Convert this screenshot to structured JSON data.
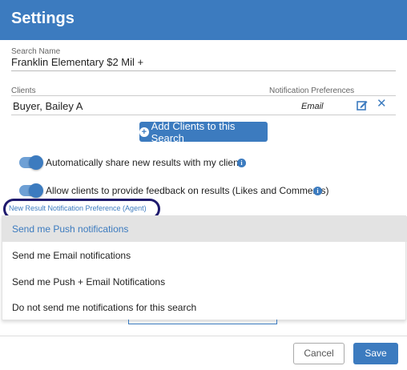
{
  "header": {
    "title": "Settings"
  },
  "search": {
    "label": "Search Name",
    "value": "Franklin Elementary $2 Mil +"
  },
  "clients": {
    "label": "Clients",
    "notification_label": "Notification Preferences",
    "rows": [
      {
        "name": "Buyer, Bailey A",
        "preference": "Email"
      }
    ],
    "add_button": "Add Clients to this Search"
  },
  "toggles": [
    {
      "label": "Automatically share new results with my clients",
      "on": true
    },
    {
      "label": "Allow clients to provide feedback on results (Likes and Comments)",
      "on": true
    }
  ],
  "agent_pref": {
    "label": "New Result Notification Preference (Agent)",
    "options": [
      "Send me Push notifications",
      "Send me Email notifications",
      "Send me Push + Email Notifications",
      "Do not send me notifications for this search"
    ],
    "selected": "Send me Push notifications"
  },
  "footer": {
    "cancel": "Cancel",
    "save": "Save"
  },
  "colors": {
    "accent": "#3c7bbf",
    "highlight_ring": "#1f1a6e"
  }
}
